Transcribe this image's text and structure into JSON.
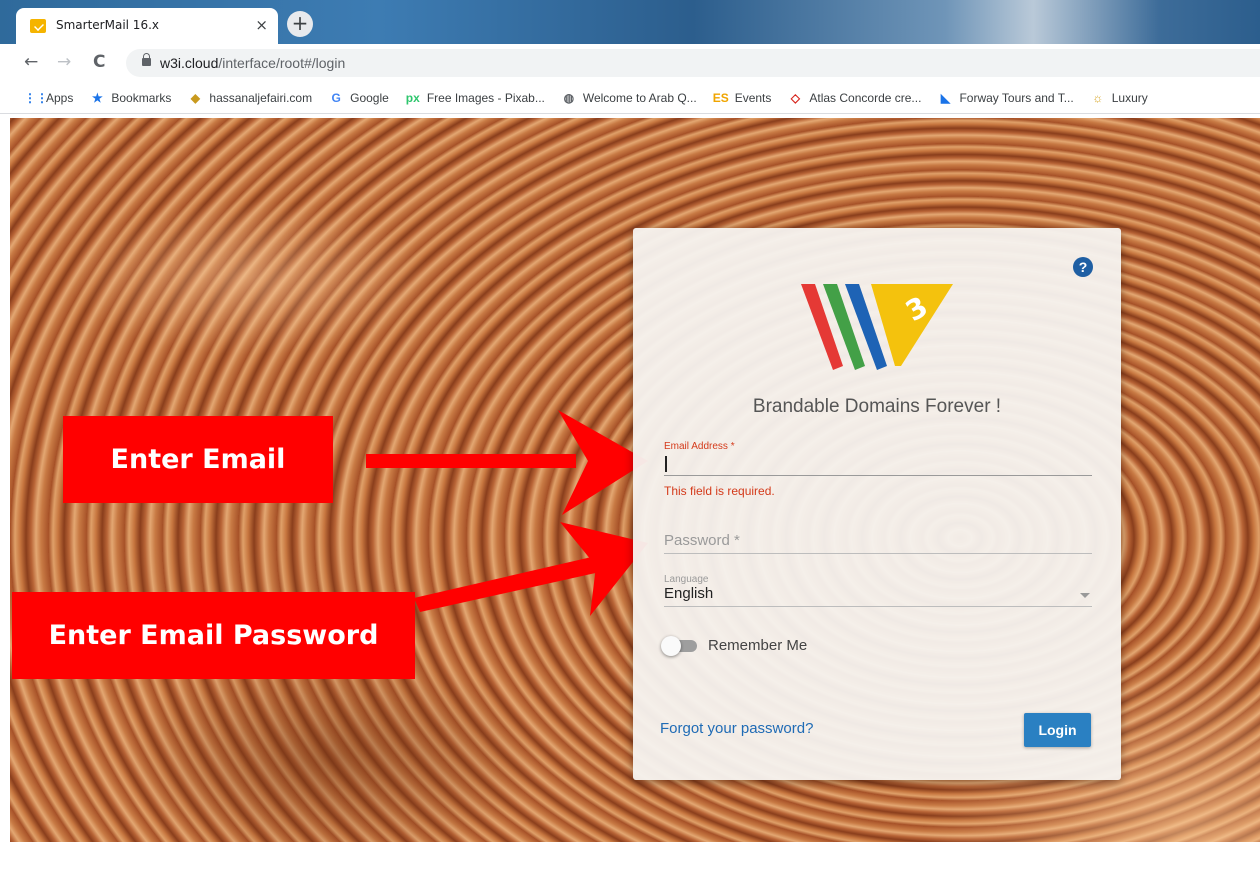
{
  "browser": {
    "tab_title": "SmarterMail 16.x",
    "tab_close": "×",
    "new_tab": "+",
    "url_host": "w3i.cloud",
    "url_path": "/interface/root#/login",
    "nav": {
      "back": "←",
      "forward": "→",
      "reload": "C"
    },
    "bookmarks": [
      {
        "label": "Apps",
        "icon": "apps-grid-icon",
        "glyph": "⋮⋮",
        "color": "#1a73e8"
      },
      {
        "label": "Bookmarks",
        "icon": "star-icon",
        "glyph": "★",
        "color": "#1a73e8"
      },
      {
        "label": "hassanaljefairi.com",
        "icon": "site-icon",
        "glyph": "◆",
        "color": "#c99a1e"
      },
      {
        "label": "Google",
        "icon": "google-icon",
        "glyph": "G",
        "color": "#4285f4"
      },
      {
        "label": "Free Images - Pixab...",
        "icon": "pixabay-icon",
        "glyph": "px",
        "color": "#2ec66d"
      },
      {
        "label": "Welcome to Arab Q...",
        "icon": "globe-icon",
        "glyph": "◍",
        "color": "#5f6368"
      },
      {
        "label": "Events",
        "icon": "events-icon",
        "glyph": "ES",
        "color": "#f0a500"
      },
      {
        "label": "Atlas Concorde cre...",
        "icon": "atlas-icon",
        "glyph": "◇",
        "color": "#d7261e"
      },
      {
        "label": "Forway Tours and T...",
        "icon": "forway-icon",
        "glyph": "◣",
        "color": "#1a73e8"
      },
      {
        "label": "Luxury",
        "icon": "luxury-icon",
        "glyph": "☼",
        "color": "#d4a017"
      }
    ]
  },
  "annotations": {
    "email_callout": "Enter Email",
    "password_callout": "Enter Email Password",
    "arrow_color": "#ff0000"
  },
  "login": {
    "help_glyph": "?",
    "tagline": "Brandable Domains Forever !",
    "email_label": "Email Address *",
    "email_value": "",
    "email_error": "This field is required.",
    "password_placeholder": "Password *",
    "language_label": "Language",
    "language_value": "English",
    "remember_label": "Remember Me",
    "remember_checked": false,
    "forgot_label": "Forgot your password?",
    "login_button": "Login",
    "logo_stripe_colors": [
      "#e53935",
      "#43a047",
      "#1e63b5",
      "#f4c20d"
    ],
    "accent_color": "#2a80c2",
    "error_color": "#d43a1a"
  }
}
